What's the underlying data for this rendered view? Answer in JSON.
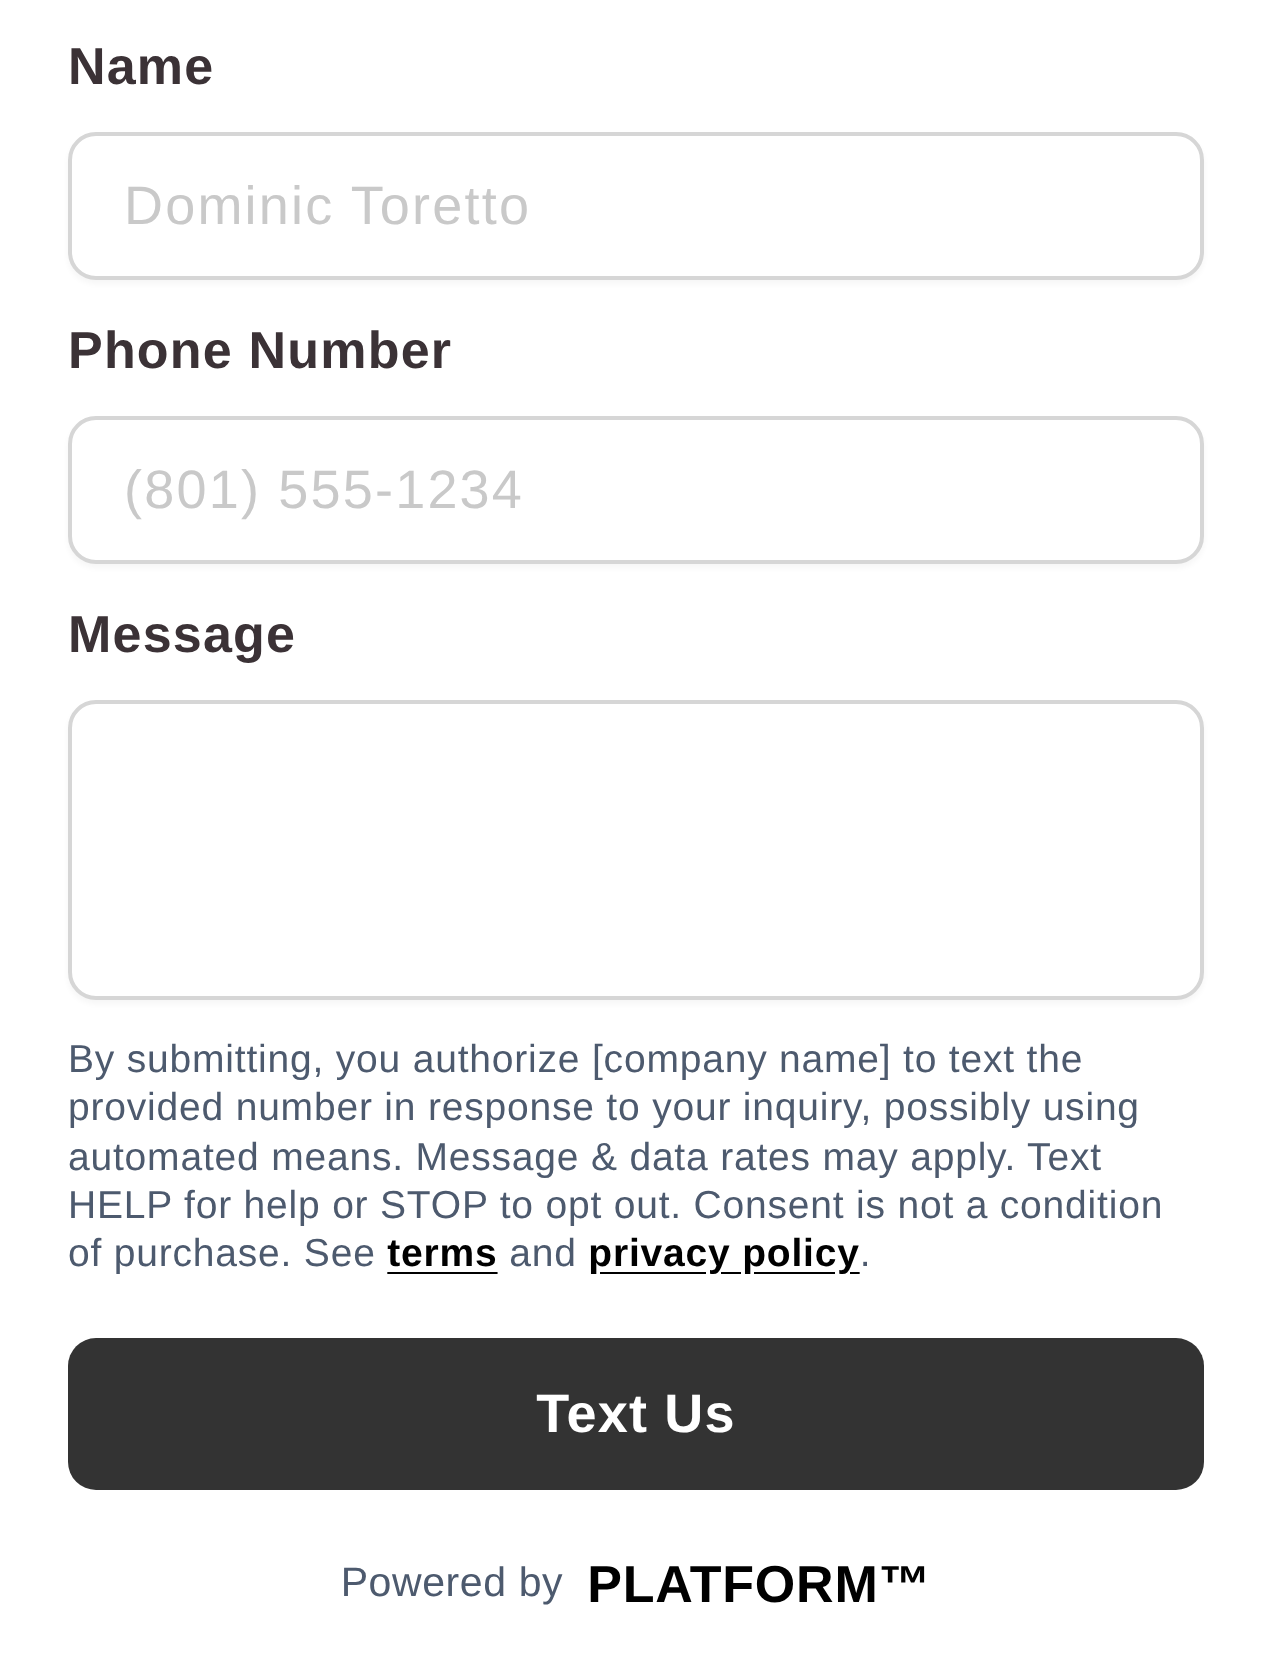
{
  "fields": [
    {
      "kind": "input",
      "label": "Name",
      "placeholder": "Dominic Toretto"
    },
    {
      "kind": "input",
      "label": "Phone Number",
      "placeholder": "(801) 555-1234"
    },
    {
      "kind": "textarea",
      "label": "Message"
    }
  ],
  "consent": [
    {
      "kind": "text",
      "text": "By submitting, you authorize [company name] to text the provided number in response to your inquiry, possibly using automated means. Message & data rates may apply. Text HELP for help or STOP to opt out. Consent is not a condition of purchase. See "
    },
    {
      "kind": "link",
      "text": "terms"
    },
    {
      "kind": "text",
      "text": " and "
    },
    {
      "kind": "link",
      "text": "privacy policy"
    },
    {
      "kind": "text",
      "text": "."
    }
  ],
  "submit_button": {
    "label": "Text Us"
  },
  "footer": {
    "text": "Powered by",
    "brand": "PLATFORM™"
  }
}
